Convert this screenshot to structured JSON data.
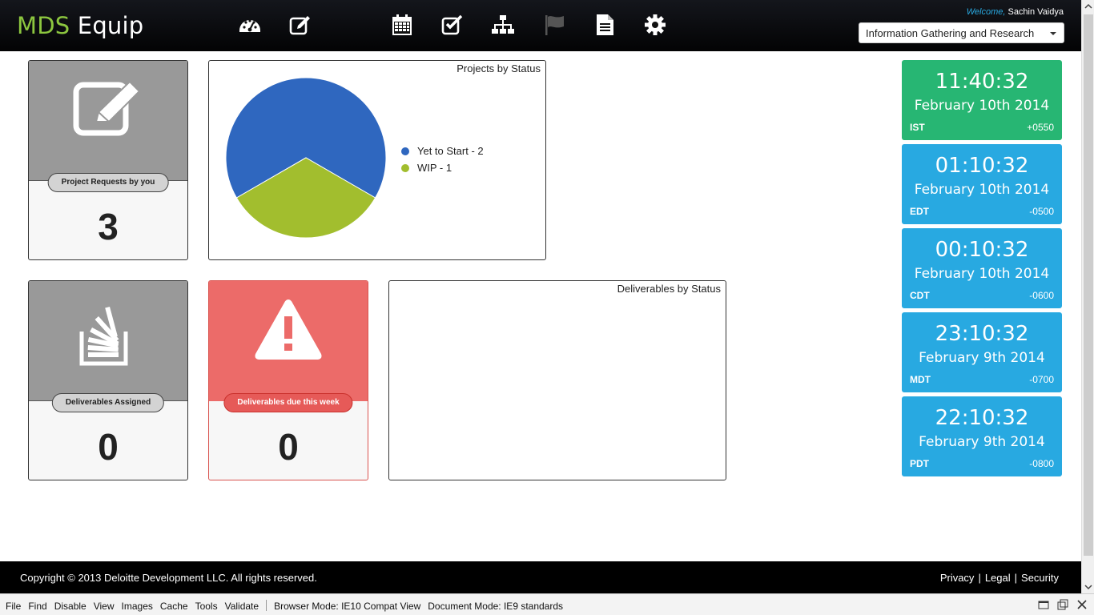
{
  "header": {
    "logo_brand": "MDS",
    "logo_rest": " Equip",
    "welcome_label": "Welcome,",
    "user_name": " Sachin Vaidya",
    "project_select": "Information Gathering and Research",
    "nav_icons": [
      "dashboard-icon",
      "edit-icon",
      "calendar-icon",
      "checkbox-icon",
      "sitemap-icon",
      "flag-icon",
      "document-icon",
      "gear-icon"
    ]
  },
  "tiles": {
    "project_requests": {
      "label": "Project Requests by you",
      "value": "3"
    },
    "deliverables_assigned": {
      "label": "Deliverables Assigned",
      "value": "0"
    },
    "deliverables_due": {
      "label": "Deliverables due this week",
      "value": "0"
    }
  },
  "panels": {
    "projects_by_status": "Projects by Status",
    "deliverables_by_status": "Deliverables by Status"
  },
  "chart_data": {
    "type": "pie",
    "title": "Projects by Status",
    "slices": [
      {
        "label": "Yet to Start - 2",
        "value": 2,
        "color": "#2f67bf"
      },
      {
        "label": "WIP - 1",
        "value": 1,
        "color": "#a2be2e"
      }
    ],
    "legend": "right"
  },
  "clocks": [
    {
      "time": "11:40:32",
      "date": "February 10th 2014",
      "tz": "IST",
      "offset": "+0550",
      "color": "#27b673"
    },
    {
      "time": "01:10:32",
      "date": "February 10th 2014",
      "tz": "EDT",
      "offset": "-0500",
      "color": "#28a9e1"
    },
    {
      "time": "00:10:32",
      "date": "February 10th 2014",
      "tz": "CDT",
      "offset": "-0600",
      "color": "#28a9e1"
    },
    {
      "time": "23:10:32",
      "date": "February 9th 2014",
      "tz": "MDT",
      "offset": "-0700",
      "color": "#28a9e1"
    },
    {
      "time": "22:10:32",
      "date": "February 9th 2014",
      "tz": "PDT",
      "offset": "-0800",
      "color": "#28a9e1"
    }
  ],
  "footer": {
    "copyright": "Copyright © 2013 Deloitte Development LLC. All rights reserved.",
    "links": [
      "Privacy",
      "Legal",
      "Security"
    ]
  },
  "devbar": {
    "menu": [
      "File",
      "Find",
      "Disable",
      "View",
      "Images",
      "Cache",
      "Tools",
      "Validate"
    ],
    "browser_mode": "Browser Mode:  IE10 Compat View",
    "document_mode": "Document Mode:  IE9 standards"
  }
}
